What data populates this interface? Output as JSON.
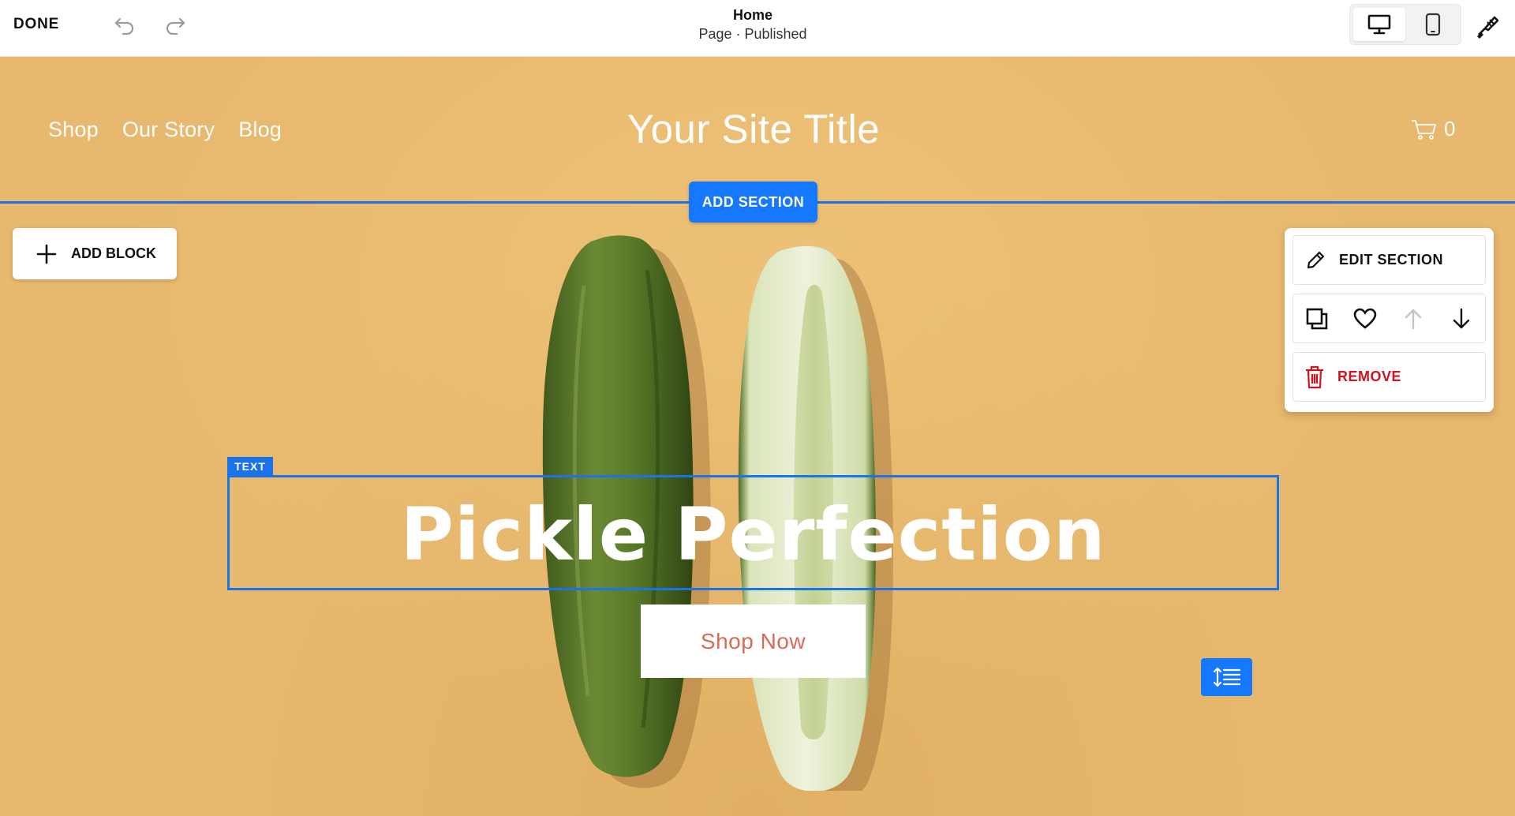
{
  "toolbar": {
    "done_label": "DONE",
    "undo_icon": "undo-icon",
    "redo_icon": "redo-icon",
    "page_name": "Home",
    "page_status": "Page · Published",
    "device_desktop_icon": "desktop-icon",
    "device_mobile_icon": "mobile-icon",
    "design_icon": "paintbrush-icon"
  },
  "site": {
    "nav": [
      "Shop",
      "Our Story",
      "Blog"
    ],
    "title": "Your Site Title",
    "cart_count": "0",
    "cart_icon": "cart-icon"
  },
  "editor": {
    "add_section_label": "ADD SECTION",
    "add_block_label": "ADD BLOCK",
    "text_tag": "TEXT",
    "section_panel": {
      "edit_label": "EDIT SECTION",
      "remove_label": "REMOVE",
      "icons": [
        "duplicate-icon",
        "heart-icon",
        "arrow-up-icon",
        "arrow-down-icon"
      ]
    },
    "spacing_icon": "line-spacing-icon"
  },
  "hero": {
    "heading": "Pickle Perfection",
    "button_label": "Shop Now"
  },
  "colors": {
    "accent": "#1677ff",
    "background": "#e7b86d",
    "remove": "#d0131d",
    "button_text": "#d96a55"
  }
}
